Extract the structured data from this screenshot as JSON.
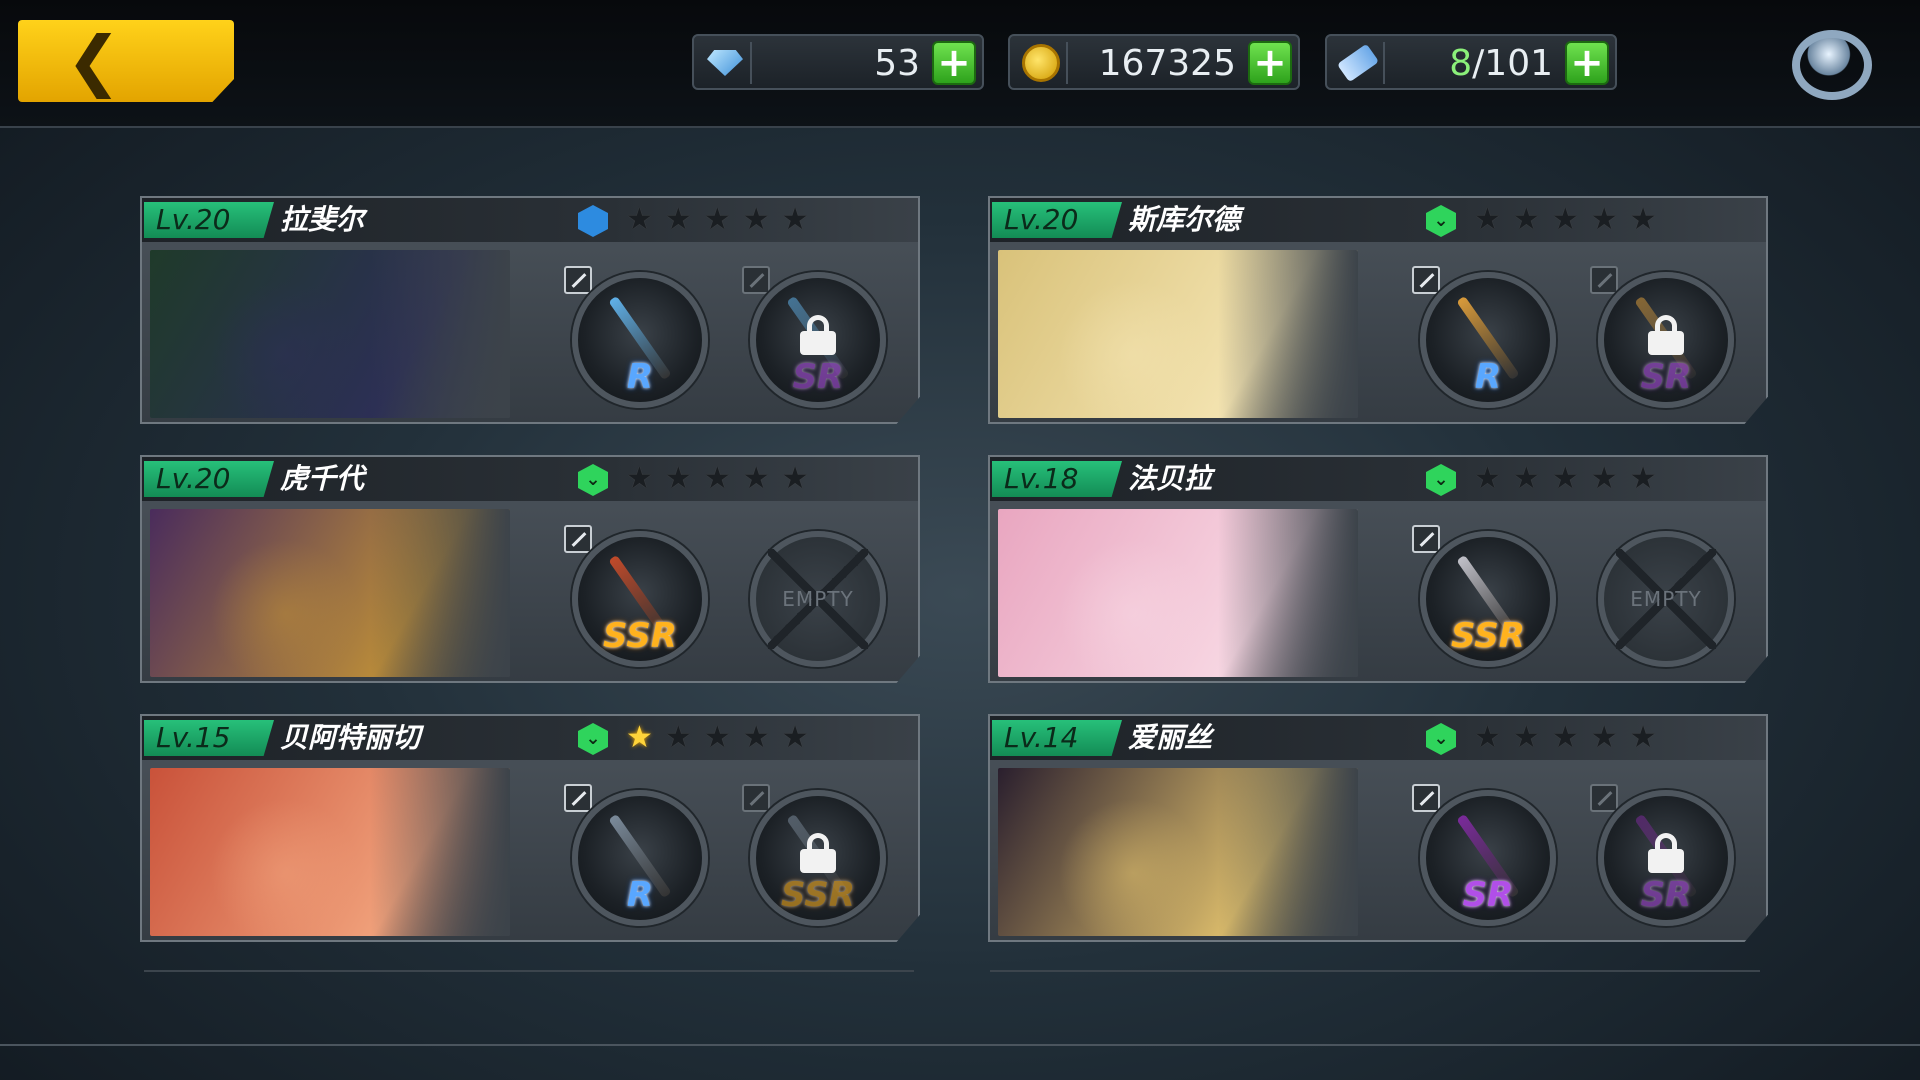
{
  "resources": [
    {
      "name": "diamonds",
      "icon": "diamond-icon",
      "value": "53",
      "highlight": ""
    },
    {
      "name": "gold",
      "icon": "coin-icon",
      "value": "167325",
      "highlight": ""
    },
    {
      "name": "tickets",
      "icon": "ticket-icon",
      "value_highlight": "8",
      "value_rest": "/101"
    }
  ],
  "plus_label": "+",
  "empty_label": "EMPTY",
  "characters": [
    {
      "level": "Lv.20",
      "name": "拉斐尔",
      "rank": "blue",
      "stars_lit": 0,
      "slots": [
        {
          "rarity": "R",
          "state": "equipped"
        },
        {
          "rarity": "SR",
          "state": "locked"
        }
      ]
    },
    {
      "level": "Lv.20",
      "name": "斯库尔德",
      "rank": "green",
      "stars_lit": 0,
      "slots": [
        {
          "rarity": "R",
          "state": "equipped"
        },
        {
          "rarity": "SR",
          "state": "locked"
        }
      ]
    },
    {
      "level": "Lv.20",
      "name": "虎千代",
      "rank": "green",
      "stars_lit": 0,
      "slots": [
        {
          "rarity": "SSR",
          "state": "equipped"
        },
        {
          "rarity": "",
          "state": "empty"
        }
      ]
    },
    {
      "level": "Lv.18",
      "name": "法贝拉",
      "rank": "green",
      "stars_lit": 0,
      "slots": [
        {
          "rarity": "SSR",
          "state": "equipped"
        },
        {
          "rarity": "",
          "state": "empty"
        }
      ]
    },
    {
      "level": "Lv.15",
      "name": "贝阿特丽切",
      "rank": "green",
      "stars_lit": 1,
      "slots": [
        {
          "rarity": "R",
          "state": "equipped"
        },
        {
          "rarity": "SSR",
          "state": "locked"
        }
      ]
    },
    {
      "level": "Lv.14",
      "name": "爱丽丝",
      "rank": "green",
      "stars_lit": 0,
      "slots": [
        {
          "rarity": "SR",
          "state": "equipped"
        },
        {
          "rarity": "SR",
          "state": "locked"
        }
      ]
    }
  ],
  "colors": {
    "back_button": "#f2b90d",
    "level_badge": "#1fa868",
    "plus_button": "#3cc02a",
    "rank_blue": "#2d8be0",
    "rank_green": "#2fd45c",
    "star_lit": "#ffd43a",
    "rarity_r": "#59a7ff",
    "rarity_sr": "#b14fe8",
    "rarity_ssr": "#ffb21e"
  }
}
